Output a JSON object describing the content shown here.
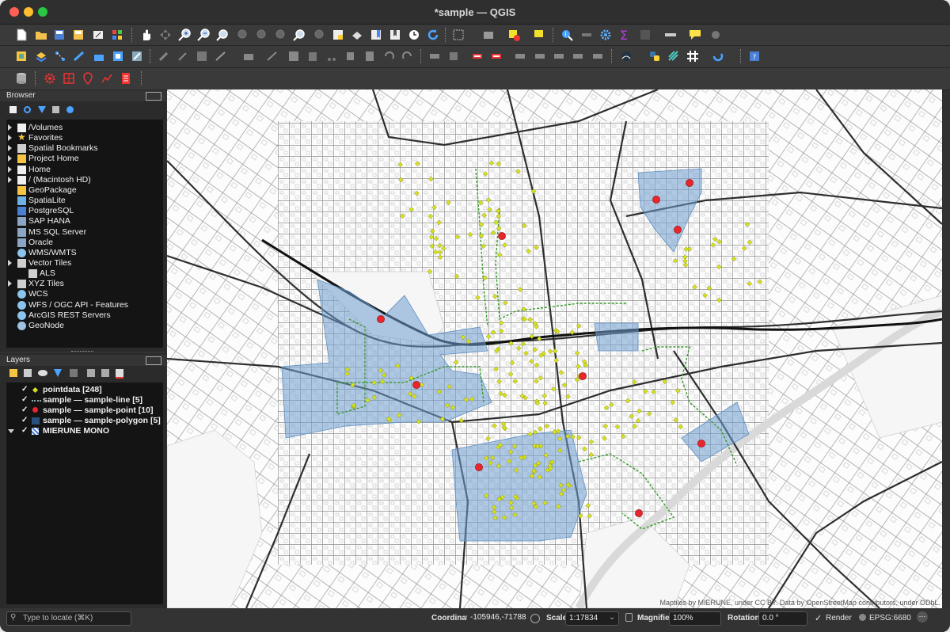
{
  "window": {
    "title": "*sample — QGIS"
  },
  "browser": {
    "title": "Browser",
    "items": [
      {
        "label": "/Volumes",
        "icon": "folder-icon"
      },
      {
        "label": "Favorites",
        "icon": "star-icon"
      },
      {
        "label": "Spatial Bookmarks",
        "icon": "bookmark-icon"
      },
      {
        "label": "Project Home",
        "icon": "project-home-icon"
      },
      {
        "label": "Home",
        "icon": "folder-icon"
      },
      {
        "label": "/ (Macintosh HD)",
        "icon": "folder-icon"
      },
      {
        "label": "GeoPackage",
        "icon": "geopackage-icon"
      },
      {
        "label": "SpatiaLite",
        "icon": "spatialite-icon"
      },
      {
        "label": "PostgreSQL",
        "icon": "postgresql-icon"
      },
      {
        "label": "SAP HANA",
        "icon": "database-icon"
      },
      {
        "label": "MS SQL Server",
        "icon": "database-icon"
      },
      {
        "label": "Oracle",
        "icon": "database-icon"
      },
      {
        "label": "WMS/WMTS",
        "icon": "globe-icon"
      },
      {
        "label": "Vector Tiles",
        "icon": "grid-icon"
      },
      {
        "label": "ALS",
        "icon": "grid-icon"
      },
      {
        "label": "XYZ Tiles",
        "icon": "grid-icon"
      },
      {
        "label": "WCS",
        "icon": "globe-icon"
      },
      {
        "label": "WFS / OGC API - Features",
        "icon": "globe-icon"
      },
      {
        "label": "ArcGIS REST Servers",
        "icon": "globe-icon"
      },
      {
        "label": "GeoNode",
        "icon": "geonode-icon"
      }
    ]
  },
  "layers": {
    "title": "Layers",
    "items": [
      {
        "label": "pointdata [248]",
        "symbol": "yellow-point"
      },
      {
        "label": "sample — sample-line [5]",
        "symbol": "dashed-line"
      },
      {
        "label": "sample — sample-point [10]",
        "symbol": "red-point"
      },
      {
        "label": "sample — sample-polygon [5]",
        "symbol": "blue-polygon"
      },
      {
        "label": "MIERUNE MONO",
        "symbol": "raster-tiles"
      }
    ]
  },
  "map": {
    "attribution": "Maptiles by MIERUNE, under CC BY. Data by OpenStreetMap contributors, under ODbL.",
    "colors": {
      "polygon": "#6f9fd0",
      "point": "#e8262b",
      "poi": "#d6e21d",
      "line": "#3a9a2e"
    }
  },
  "status": {
    "locate_placeholder": "Type to locate (⌘K)",
    "coordinate_label": "Coordinate",
    "coordinate_value": "-105946,-71788",
    "scale_label": "Scale",
    "scale_value": "1:17834",
    "magnifier_label": "Magnifier",
    "magnifier_value": "100%",
    "rotation_label": "Rotation",
    "rotation_value": "0.0 °",
    "render_label": "Render",
    "epsg_label": "EPSG:6680"
  }
}
